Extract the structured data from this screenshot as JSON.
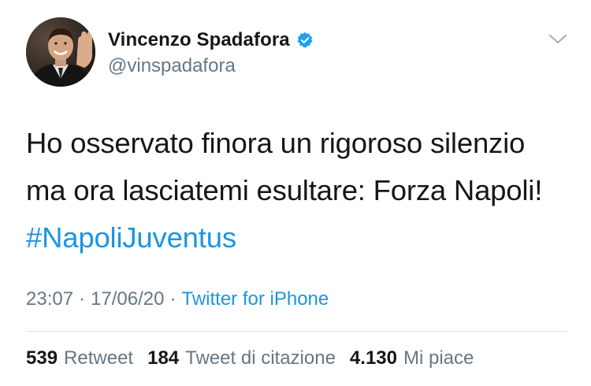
{
  "author": {
    "display_name": "Vincenzo Spadafora",
    "handle": "@vinspadafora",
    "verified": true
  },
  "tweet": {
    "text_plain": "Ho osservato finora un rigoroso silenzio ma ora lasciatemi esultare: Forza Napoli! ",
    "hashtag": "#NapoliJuventus"
  },
  "meta": {
    "time": "23:07",
    "separator": "·",
    "date": "17/06/20",
    "source": "Twitter for iPhone"
  },
  "stats": {
    "retweets": "539",
    "retweets_label": "Retweet",
    "quotes": "184",
    "quotes_label": "Tweet di citazione",
    "likes": "4.130",
    "likes_label": "Mi piace"
  },
  "icons": {
    "verified": "verified-badge-icon",
    "more": "chevron-down-icon"
  },
  "colors": {
    "link": "#1b95e0",
    "secondary_text": "#657786",
    "primary_text": "#14171a",
    "divider": "#e1e8ed"
  }
}
